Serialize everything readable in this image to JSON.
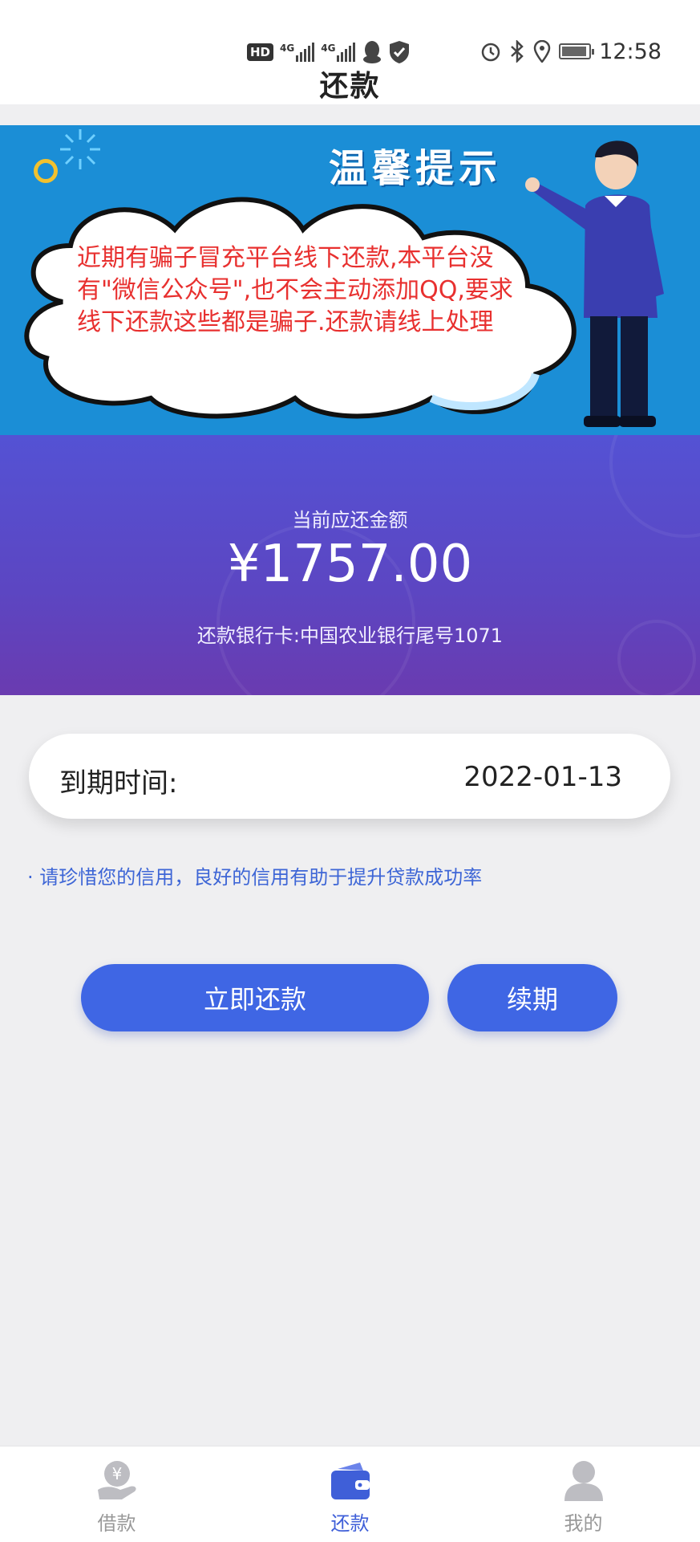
{
  "status_bar": {
    "left_icons": [
      "hd-icon",
      "signal-4g-icon",
      "signal-4g-icon",
      "qq-icon",
      "shield-icon"
    ],
    "hd_label": "HD",
    "network_label_1": "4G",
    "network_label_2": "4G",
    "right_icons": [
      "alarm-icon",
      "bluetooth-icon",
      "location-icon",
      "battery-icon"
    ],
    "time": "12:58"
  },
  "header": {
    "title": "还款"
  },
  "banner": {
    "title": "温馨提示",
    "message": "近期有骗子冒充平台线下还款,本平台没有\"微信公众号\",也不会主动添加QQ,要求线下还款这些都是骗子.还款请线上处理"
  },
  "amount": {
    "label": "当前应还金额",
    "value": "¥1757.00",
    "bank_info": "还款银行卡:中国农业银行尾号1071"
  },
  "due": {
    "label": "到期时间:",
    "date": "2022-01-13"
  },
  "tip": "· 请珍惜您的信用，良好的信用有助于提升贷款成功率",
  "actions": {
    "pay_now": "立即还款",
    "renew": "续期"
  },
  "bottom_nav": {
    "items": [
      {
        "label": "借款",
        "icon": "loan-hand-icon",
        "active": false
      },
      {
        "label": "还款",
        "icon": "wallet-icon",
        "active": true
      },
      {
        "label": "我的",
        "icon": "user-icon",
        "active": false
      }
    ]
  },
  "colors": {
    "primary": "#3f66e4",
    "banner_bg": "#1b8ed6",
    "warning_text": "#e8302f",
    "amount_gradient_top": "#5452d4",
    "amount_gradient_bottom": "#6a3bb0",
    "tip_text": "#3e66d6",
    "nav_active": "#3f5fd8",
    "nav_inactive": "#999999"
  }
}
